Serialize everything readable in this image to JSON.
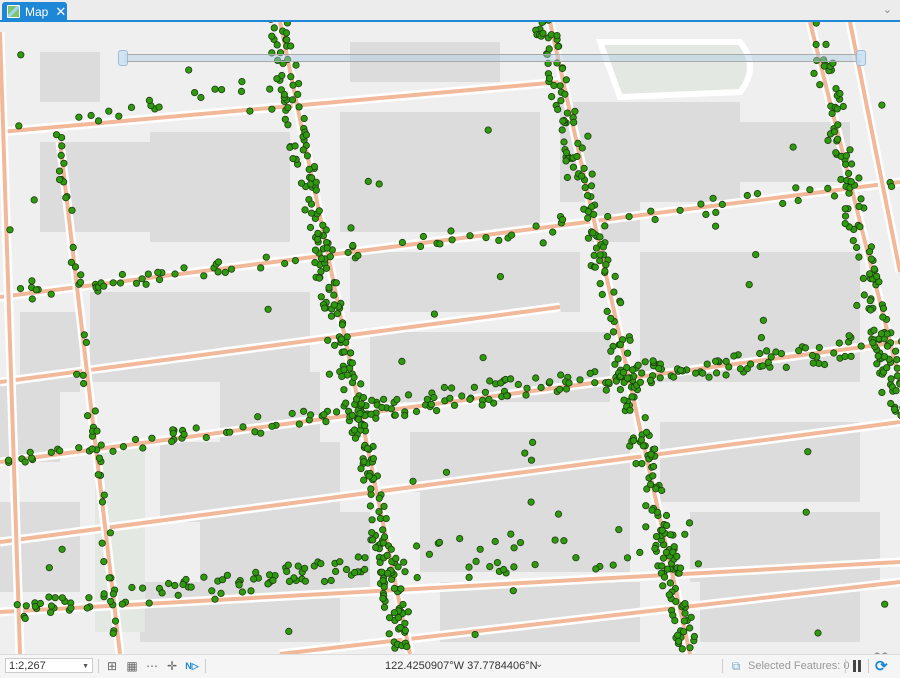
{
  "tab": {
    "label": "Map",
    "icon": "map-icon",
    "close_icon": "close-icon"
  },
  "accent_color": "#1e88d6",
  "map": {
    "basemap": "Light Gray Canvas",
    "point_color": "#2e9a0e",
    "point_outline": "#1f3d12",
    "road_color": "#f2b89a",
    "building_color": "#dcdcdc",
    "park_color": "#e4e8e2"
  },
  "time_slider": {
    "visible": true
  },
  "status": {
    "scale": "1:2,267",
    "coordinates": "122.4250907°W 37.7784406°N",
    "selected_features_label": "Selected Features: 0",
    "tools": [
      "add-grid-icon",
      "table-icon",
      "layer-tools-icon",
      "crosshair-icon",
      "north-arrow-icon"
    ]
  }
}
